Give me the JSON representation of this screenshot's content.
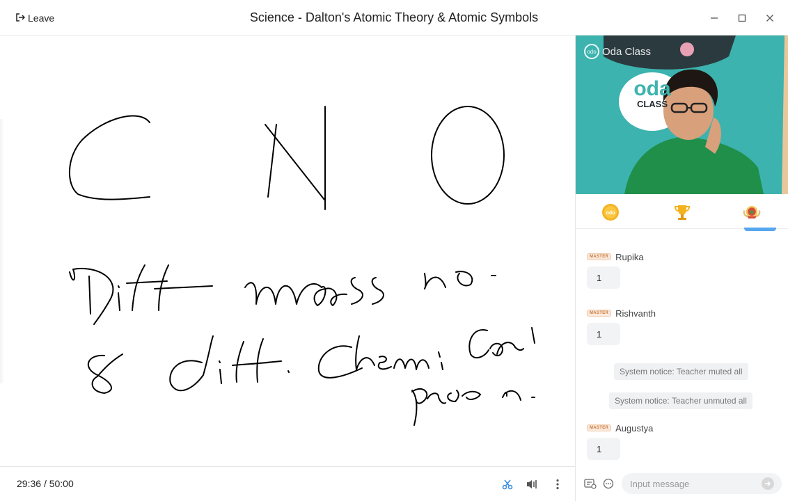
{
  "window": {
    "title": "Science - Dalton's Atomic Theory & Atomic Symbols",
    "leave_label": "Leave"
  },
  "whiteboard": {
    "handwritten_lines": [
      "C N O",
      "Diff mass no.",
      "& diff. Chemical",
      "Prop n."
    ]
  },
  "bottombar": {
    "elapsed": "29:36",
    "separator": "/",
    "total": "50:00"
  },
  "video": {
    "watermark": "Oda Class",
    "watermark_logo": "odo",
    "backdrop_logo": "oda",
    "backdrop_sub": "CLASS"
  },
  "tabs": {
    "coin_logo": "odo",
    "icons": [
      "oda-coin-icon",
      "trophy-icon",
      "medal-badge-icon"
    ]
  },
  "chat": {
    "messages": [
      {
        "badge": "MASTER",
        "sender": "Rupika",
        "text": "1"
      },
      {
        "badge": "MASTER",
        "sender": "Rishvanth",
        "text": "1"
      },
      {
        "badge": "MASTER",
        "sender": "Augustya",
        "text": "1"
      }
    ],
    "notices": [
      "System notice: Teacher muted all",
      "System notice: Teacher unmuted all"
    ],
    "input_placeholder": "Input message"
  },
  "colors": {
    "accent": "#57a6f0",
    "badge_text": "#c77a3a",
    "bubble_bg": "#f2f3f5"
  }
}
